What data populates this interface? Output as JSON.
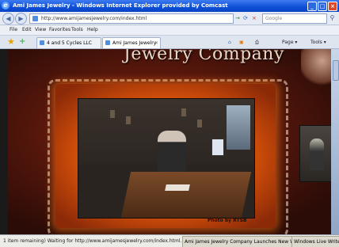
{
  "window": {
    "title": "Ami James Jewelry - Windows Internet Explorer provided by Comcast",
    "controls": {
      "minimize": "_",
      "maximize": "□",
      "close": "×"
    }
  },
  "address_bar": {
    "back_icon": "back-arrow-icon",
    "back_glyph": "◀",
    "forward_glyph": "▶",
    "url": "http://www.amijamesjewelry.com/index.html",
    "search_placeholder": "Google",
    "go_glyph": "→",
    "refresh_glyph": "⟳",
    "stop_glyph": "×",
    "search_glyph": "⚲"
  },
  "menu": {
    "items": [
      "File",
      "Edit",
      "View",
      "Favorites",
      "Tools",
      "Help"
    ]
  },
  "tabs": [
    {
      "label": "4 and 5 Cycles LLC"
    },
    {
      "label": "Ami James Jewelry"
    }
  ],
  "toolbar": {
    "favorites_glyph": "★",
    "add_favorites_glyph": "+",
    "home_glyph": "⌂",
    "feeds_glyph": "▣",
    "print_glyph": "⎙",
    "page_label": "Page ▾",
    "tools_label": "Tools ▾"
  },
  "page": {
    "site_title": "Jewelry Company",
    "photo_credit": "Photo by RTSB"
  },
  "status": {
    "text": "1 item remaining) Waiting for http://www.amijamesjewelry.com/index.html...",
    "task_1": "Ami James Jewelry Company Launches New Web Site",
    "task_2": "Windows Live Writer"
  }
}
